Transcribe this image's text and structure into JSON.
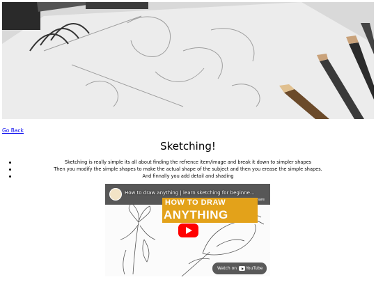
{
  "nav": {
    "back_label": "Go Back"
  },
  "page": {
    "title": "Sketching!"
  },
  "steps": [
    "Sketching is really simple its all about finding the refrence item/image and break it down to simpler shapes",
    "Then you modify the simple shapes to make the actual shape of the subject and then you erease the simple shapes.",
    "And finnally you add detail and shading"
  ],
  "video": {
    "title": "How to draw anything | learn sketching for beginne...",
    "share_label": "Share",
    "thumb_line1": "HOW TO DRAW",
    "thumb_line2": "ANYTHING",
    "watch_label": "Watch on",
    "platform": "YouTube"
  }
}
